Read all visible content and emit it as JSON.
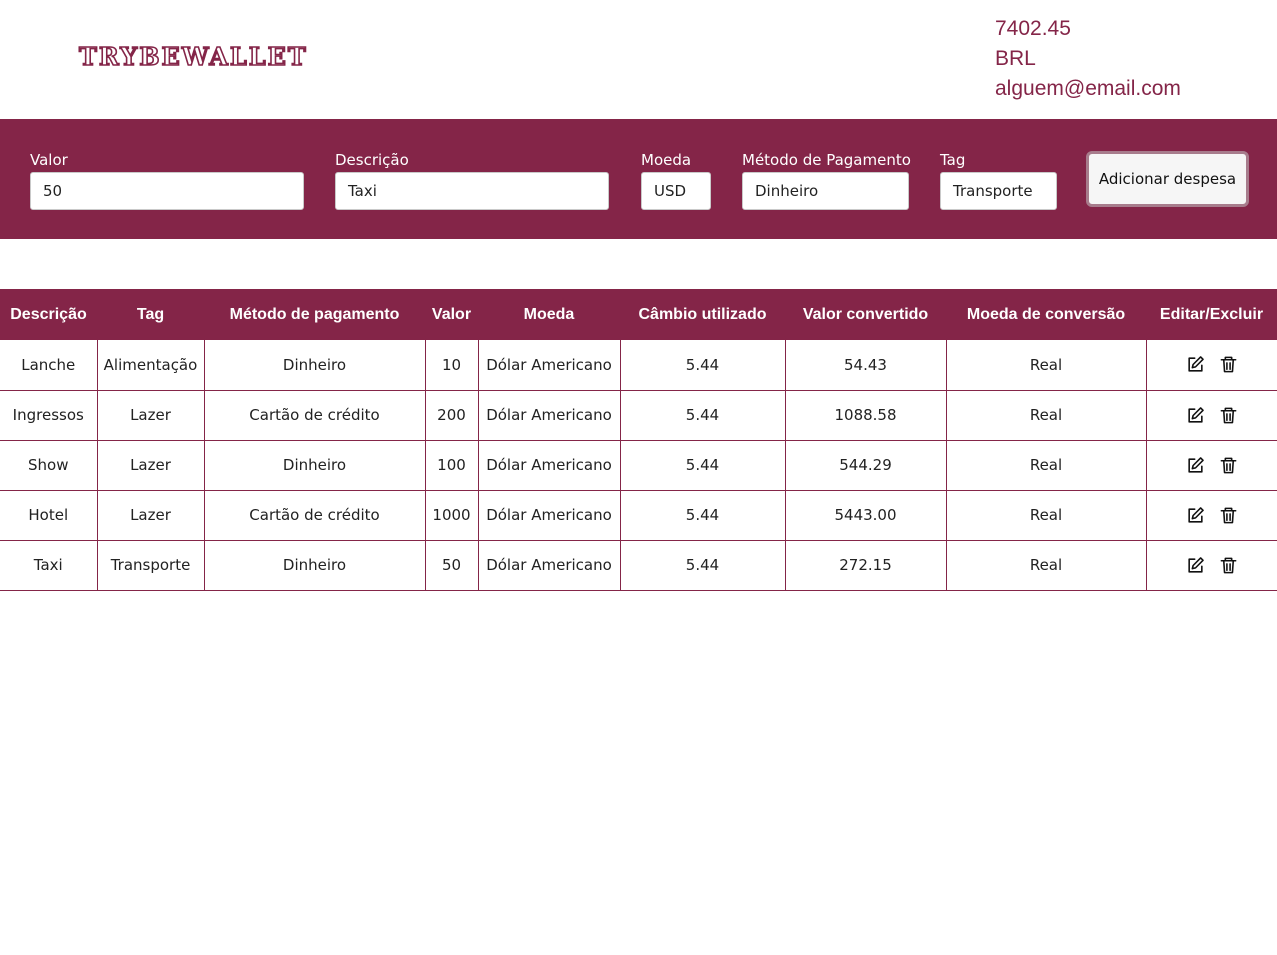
{
  "header": {
    "logo": "TRYBEWALLET",
    "total": "7402.45",
    "currency": "BRL",
    "email": "alguem@email.com"
  },
  "form": {
    "valor_label": "Valor",
    "valor_value": "50",
    "descricao_label": "Descrição",
    "descricao_value": "Taxi",
    "moeda_label": "Moeda",
    "moeda_value": "USD",
    "metodo_label": "Método de Pagamento",
    "metodo_value": "Dinheiro",
    "tag_label": "Tag",
    "tag_value": "Transporte",
    "add_button": "Adicionar despesa"
  },
  "table": {
    "headers": [
      "Descrição",
      "Tag",
      "Método de pagamento",
      "Valor",
      "Moeda",
      "Câmbio utilizado",
      "Valor convertido",
      "Moeda de conversão",
      "Editar/Excluir"
    ],
    "rows": [
      {
        "descricao": "Lanche",
        "tag": "Alimentação",
        "metodo": "Dinheiro",
        "valor": "10",
        "moeda": "Dólar Americano",
        "cambio": "5.44",
        "convertido": "54.43",
        "conversao": "Real"
      },
      {
        "descricao": "Ingressos",
        "tag": "Lazer",
        "metodo": "Cartão de crédito",
        "valor": "200",
        "moeda": "Dólar Americano",
        "cambio": "5.44",
        "convertido": "1088.58",
        "conversao": "Real"
      },
      {
        "descricao": "Show",
        "tag": "Lazer",
        "metodo": "Dinheiro",
        "valor": "100",
        "moeda": "Dólar Americano",
        "cambio": "5.44",
        "convertido": "544.29",
        "conversao": "Real"
      },
      {
        "descricao": "Hotel",
        "tag": "Lazer",
        "metodo": "Cartão de crédito",
        "valor": "1000",
        "moeda": "Dólar Americano",
        "cambio": "5.44",
        "convertido": "5443.00",
        "conversao": "Real"
      },
      {
        "descricao": "Taxi",
        "tag": "Transporte",
        "metodo": "Dinheiro",
        "valor": "50",
        "moeda": "Dólar Americano",
        "cambio": "5.44",
        "convertido": "272.15",
        "conversao": "Real"
      }
    ]
  },
  "icons": {
    "edit": "edit-icon",
    "delete": "trash-icon"
  },
  "colors": {
    "brand": "#842548",
    "white": "#ffffff"
  }
}
